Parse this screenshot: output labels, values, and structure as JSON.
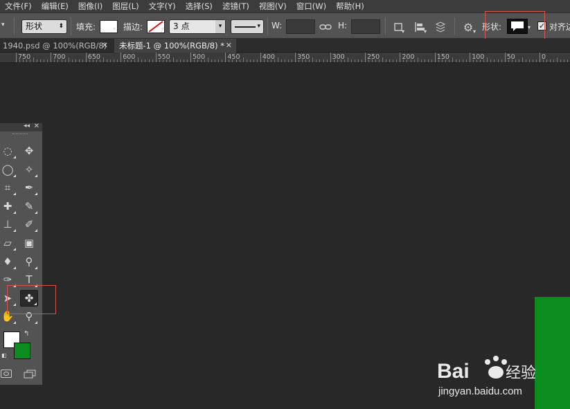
{
  "menu": [
    "文件(F)",
    "编辑(E)",
    "图像(I)",
    "图层(L)",
    "文字(Y)",
    "选择(S)",
    "滤镜(T)",
    "视图(V)",
    "窗口(W)",
    "帮助(H)"
  ],
  "options": {
    "mode_value": "形状",
    "fill_label": "填充:",
    "stroke_label": "描边:",
    "stroke_width": "3 点",
    "w_label": "W:",
    "h_label": "H:",
    "shape_label": "形状:",
    "align_edges_label": "对齐边缘",
    "fill_color": "#ffffff"
  },
  "tabs": [
    {
      "label": "1940.psd @ 100%(RGB/8)",
      "active": false
    },
    {
      "label": "未标题-1 @ 100%(RGB/8) *",
      "active": true
    }
  ],
  "ruler": {
    "labels": [
      "750",
      "700",
      "650",
      "600",
      "550",
      "500",
      "450",
      "400",
      "350",
      "300",
      "250",
      "200",
      "150",
      "100",
      "50",
      "0"
    ]
  },
  "tool_icons": [
    "elliptical-marquee-icon",
    "move-icon",
    "lasso-icon",
    "magic-wand-icon",
    "crop-icon",
    "eyedropper-icon",
    "healing-brush-icon",
    "brush-icon",
    "clone-stamp-icon",
    "history-brush-icon",
    "eraser-icon",
    "gradient-icon",
    "blur-icon",
    "dodge-icon",
    "pen-icon",
    "type-icon",
    "path-selection-icon",
    "custom-shape-icon",
    "hand-icon",
    "zoom-icon"
  ],
  "colors": {
    "foreground": "#ffffff",
    "background": "#0a8d1e",
    "canvas": "#282828",
    "highlight": "#d9534f"
  },
  "watermark": "Bai 经验 jingyan.baidu.com"
}
